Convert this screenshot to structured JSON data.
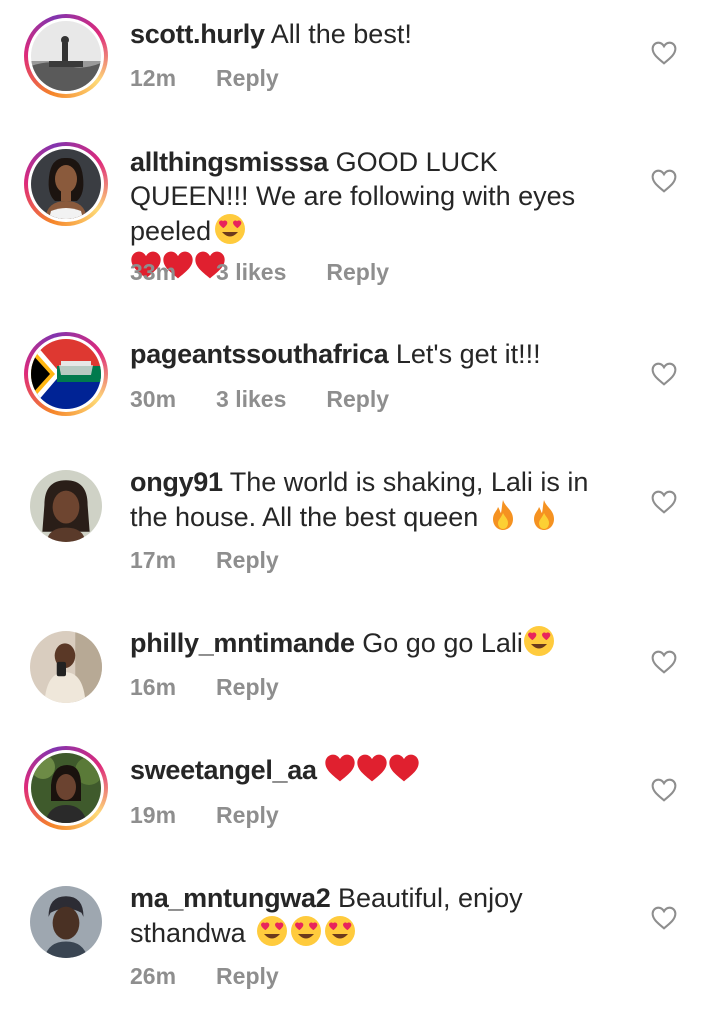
{
  "comments": [
    {
      "username": "scott.hurly",
      "text": "All the best!",
      "time": "12m",
      "likes": "",
      "reply": "Reply",
      "avatar_icon": "person-on-hill-avatar"
    },
    {
      "username": "allthingsmisssa",
      "text": "GOOD LUCK QUEEN!!! We are following with eyes peeled",
      "time": "33m",
      "likes": "3 likes",
      "reply": "Reply",
      "avatar_icon": "woman-portrait-avatar"
    },
    {
      "username": "pageantssouthafrica",
      "text": "Let's get it!!!",
      "time": "30m",
      "likes": "3 likes",
      "reply": "Reply",
      "avatar_icon": "south-africa-flag-avatar"
    },
    {
      "username": "ongy91",
      "text": "The world is shaking, Lali is in the house. All the best queen",
      "time": "17m",
      "likes": "",
      "reply": "Reply",
      "avatar_icon": "woman-braids-avatar"
    },
    {
      "username": "philly_mntimande",
      "text": "Go go go Lali",
      "time": "16m",
      "likes": "",
      "reply": "Reply",
      "avatar_icon": "man-selfie-avatar"
    },
    {
      "username": "sweetangel_aa",
      "text": "",
      "time": "19m",
      "likes": "",
      "reply": "Reply",
      "avatar_icon": "woman-outdoor-avatar"
    },
    {
      "username": "ma_mntungwa2",
      "text": "Beautiful, enjoy sthandwa",
      "time": "26m",
      "likes": "",
      "reply": "Reply",
      "avatar_icon": "woman-headwrap-avatar"
    }
  ],
  "colors": {
    "heart_red": "#e0202f",
    "meta_gray": "#8e8e8e",
    "text": "#262626"
  }
}
